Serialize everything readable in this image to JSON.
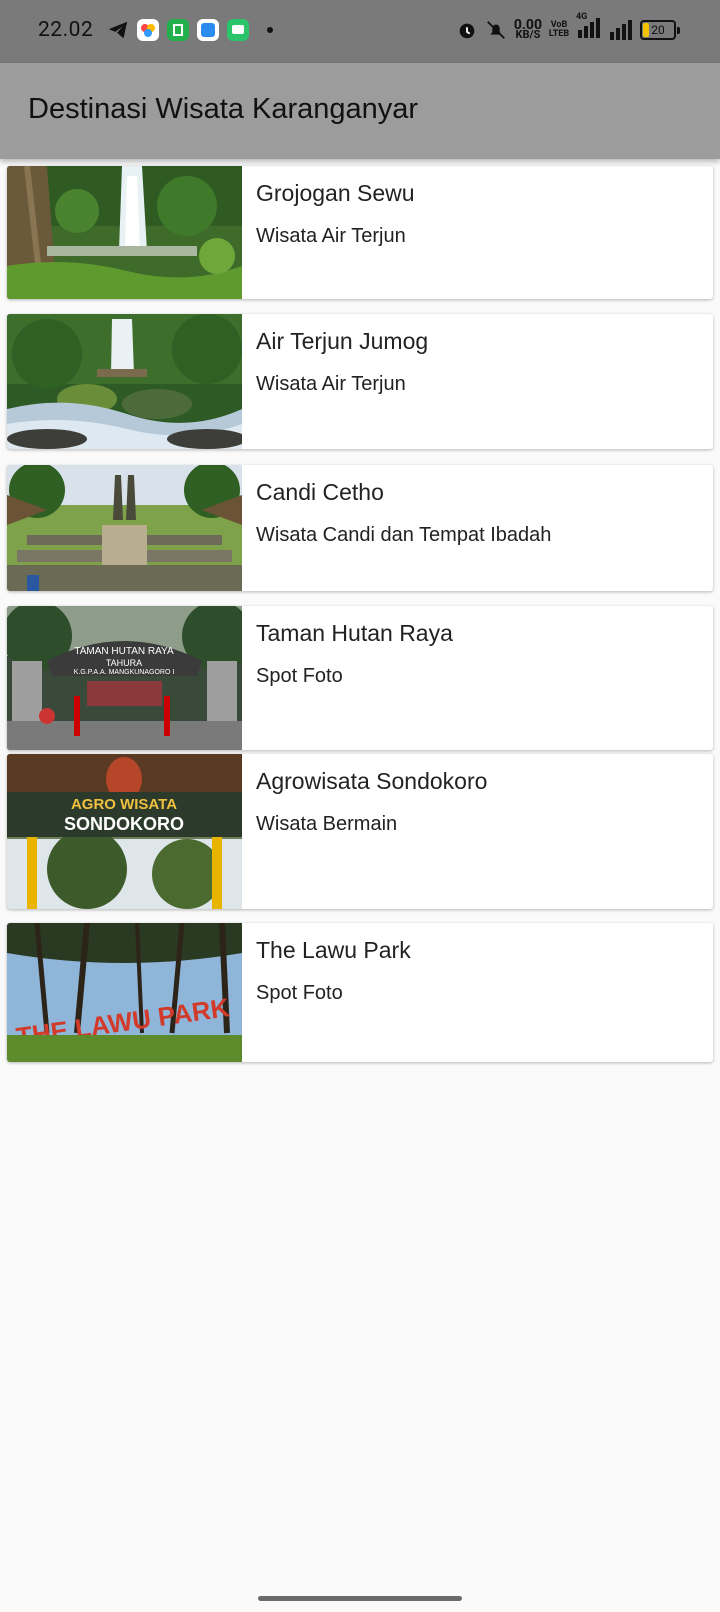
{
  "status_bar": {
    "time": "22.02",
    "speed_value": "0.00",
    "speed_unit": "KB/S",
    "network_type": "4G",
    "volte": "VoB LTEB",
    "battery": "20",
    "icons": [
      "telegram-icon",
      "photos-icon",
      "store-icon",
      "browser-icon",
      "messages-icon",
      "alarm-icon",
      "mute-icon",
      "signal-icon",
      "signal-icon",
      "battery-icon"
    ]
  },
  "appbar": {
    "title": "Destinasi Wisata Karanganyar"
  },
  "destinations": [
    {
      "name": "Grojogan Sewu",
      "category": "Wisata Air Terjun",
      "image": "waterfall-photo"
    },
    {
      "name": "Air Terjun Jumog",
      "category": "Wisata Air Terjun",
      "image": "waterfall-photo"
    },
    {
      "name": "Candi Cetho",
      "category": "Wisata Candi dan Tempat Ibadah",
      "image": "temple-photo"
    },
    {
      "name": "Taman Hutan Raya",
      "category": "Spot Foto",
      "image": "forest-gate-photo"
    },
    {
      "name": "Agrowisata Sondokoro",
      "category": "Wisata Bermain",
      "image": "agro-sign-photo"
    },
    {
      "name": "The Lawu Park",
      "category": "Spot Foto",
      "image": "park-sign-photo"
    }
  ],
  "thumb_text": {
    "tahura_gate": "TAMAN HUTAN RAYA",
    "tahura_sub": "TAHURA",
    "tahura_sub2": "K.G.P.A.A. MANGKUNAGORO I",
    "sondokoro_top": "AGRO WISATA",
    "sondokoro_main": "SONDOKORO",
    "lawu_sign": "THE LAWU PARK"
  }
}
